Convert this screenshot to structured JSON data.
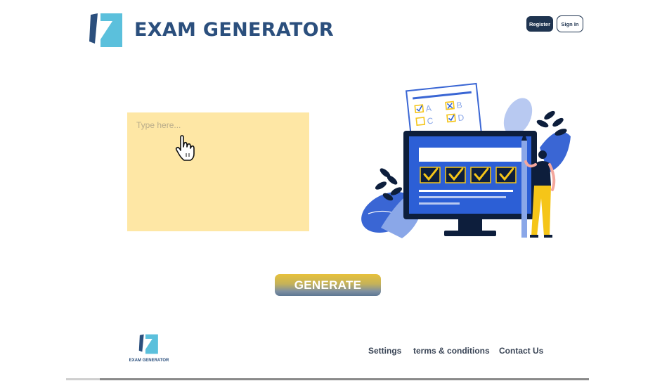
{
  "header": {
    "brand_name": "EXAM GENERATOR",
    "logo_icon": "exam-generator-logo",
    "register_label": "Register",
    "signin_label": "Sign In"
  },
  "main": {
    "input_placeholder": "Type here...",
    "input_value": "",
    "cursor_icon": "hand-pointer-icon",
    "illustration": "exam-quiz-illustration",
    "generate_label": "GENERATE"
  },
  "footer": {
    "brand_name": "EXAM GENERATOR",
    "links": [
      "Settings",
      "terms & conditions",
      "Contact Us"
    ]
  },
  "colors": {
    "brand_navy": "#2b4f7d",
    "logo_light_blue": "#5bc0dc",
    "input_bg": "#fee7a5",
    "register_bg": "#1f3450",
    "illustration_blue": "#2c5fd6",
    "check_yellow": "#f5c518"
  }
}
